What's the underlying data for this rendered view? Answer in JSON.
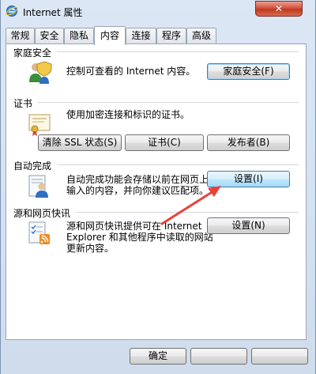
{
  "window": {
    "title": "Internet 属性",
    "close_symbol": "✕"
  },
  "tabs": [
    {
      "label": "常规",
      "active": false
    },
    {
      "label": "安全",
      "active": false
    },
    {
      "label": "隐私",
      "active": false
    },
    {
      "label": "内容",
      "active": true
    },
    {
      "label": "连接",
      "active": false
    },
    {
      "label": "程序",
      "active": false
    },
    {
      "label": "高级",
      "active": false
    }
  ],
  "family_safety": {
    "heading": "家庭安全",
    "description": "控制可查看的 Internet 内容。",
    "button_label": "家庭安全(F)"
  },
  "certificates": {
    "heading": "证书",
    "description": "使用加密连接和标识的证书。",
    "clear_ssl_label": "清除 SSL 状态(S)",
    "certificates_label": "证书(C)",
    "publishers_label": "发布者(B)"
  },
  "autocomplete": {
    "heading": "自动完成",
    "description_line1": "自动完成功能会存储以前在网页上",
    "description_line2": "输入的内容，并向你建议匹配项。",
    "settings_label": "设置(I)"
  },
  "feeds": {
    "heading": "源和网页快讯",
    "description_line1": "源和网页快讯提供可在 Internet",
    "description_line2": "Explorer 和其他程序中读取的网站",
    "description_line3": "更新内容。",
    "settings_label": "设置(N)"
  },
  "footer": {
    "ok_label": "确定"
  },
  "colors": {
    "annotation_arrow": "#e8423a",
    "close_button": "#c0391f"
  }
}
